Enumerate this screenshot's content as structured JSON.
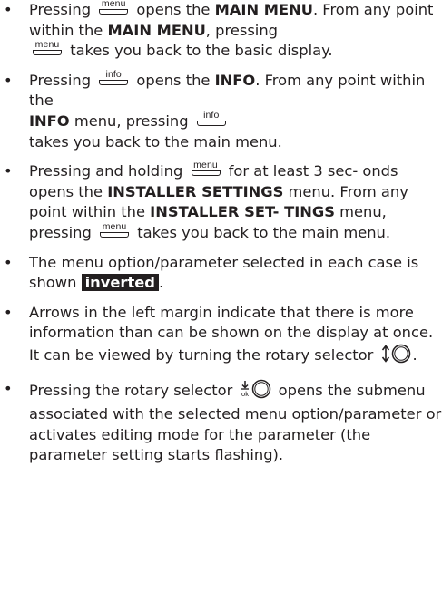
{
  "bullet_glyph": "•",
  "keys": {
    "menu": "menu",
    "info": "info"
  },
  "icons": {
    "rotary_turn": "rotary-selector-turn-icon",
    "rotary_press": "rotary-selector-press-icon"
  },
  "items": [
    {
      "t1": "Pressing",
      "t2": "opens the",
      "b1": "MAIN MENU",
      "t3": ". From any point within the",
      "b2": "MAIN MENU",
      "t4": ", pressing",
      "t5": "takes you back to the basic display."
    },
    {
      "t1": "Pressing",
      "t2": "opens the",
      "b1": "INFO",
      "t3": ". From any point within the",
      "b2": "INFO",
      "t4": "menu, pressing",
      "t5": "takes you back to the main menu."
    },
    {
      "t1": "Pressing and holding",
      "t2": "for at least 3 sec- onds opens the",
      "b1": "INSTALLER SETTINGS",
      "t3": "menu. From any point within the",
      "b2": "INSTALLER SET- TINGS",
      "t4": "menu, pressing",
      "t5": "takes you back to the main menu."
    },
    {
      "t1": "The menu option/parameter selected in each case is shown",
      "inverted": "inverted",
      "t2": "."
    },
    {
      "t1": "Arrows in the left margin indicate that there is more information than can be shown on the display at once. It can be viewed by turning the rotary selector",
      "t2": "."
    },
    {
      "t1": "Pressing the rotary selector",
      "t2": "opens the submenu associated with the selected menu option/parameter or activates editing mode for the parameter (the parameter setting starts flashing)."
    }
  ]
}
